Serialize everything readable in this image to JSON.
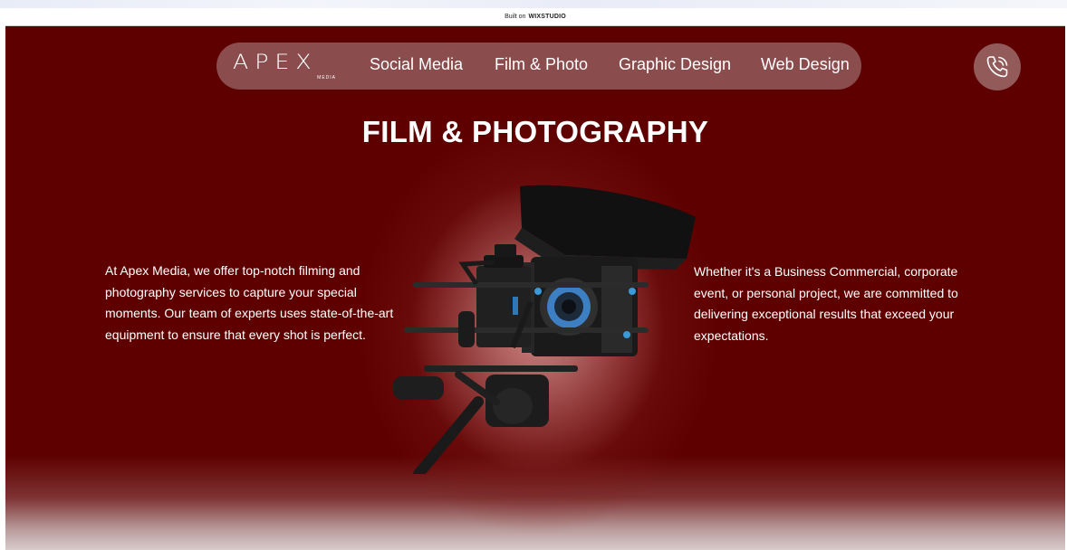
{
  "wix_banner": {
    "prefix": "Built on",
    "brand_bold": "WIX",
    "brand_rest": "STUDIO"
  },
  "logo": {
    "text": "APEX",
    "sub": "MEDIA"
  },
  "nav": {
    "items": [
      {
        "label": "Social Media"
      },
      {
        "label": "Film & Photo"
      },
      {
        "label": "Graphic Design"
      },
      {
        "label": "Web Design"
      }
    ]
  },
  "contact": {
    "icon": "phone-icon"
  },
  "hero": {
    "title": "FILM & PHOTOGRAPHY",
    "left_text": "At Apex Media, we offer top-notch filming and photography services to capture your special moments. Our team of experts uses state-of-the-art equipment to ensure that every shot is perfect.",
    "right_text": "Whether it's a Business Commercial, corporate event, or personal project, we are committed to delivering exceptional results that exceed your expectations.",
    "image": "camera-rig-image"
  },
  "colors": {
    "background": "#600000",
    "nav_pill": "#8c5050",
    "text": "#ffffff"
  }
}
